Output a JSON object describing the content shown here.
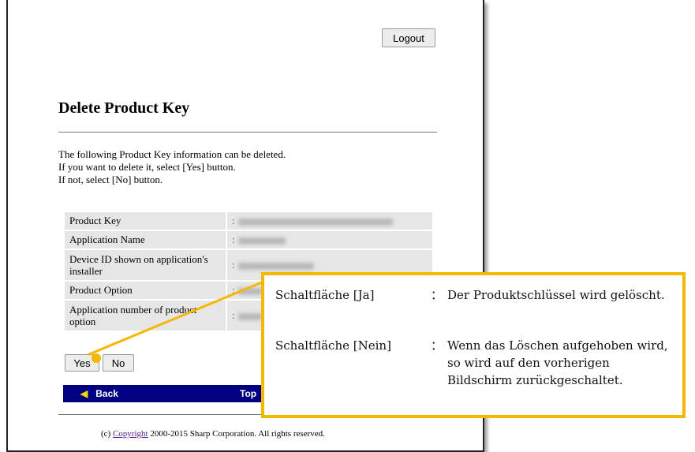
{
  "header": {
    "logout_label": "Logout"
  },
  "page": {
    "title": "Delete Product Key",
    "intro_lines": [
      "The following Product Key information can be deleted.",
      "If you want to delete it, select [Yes] button.",
      "If not, select [No] button."
    ]
  },
  "table": {
    "rows": [
      {
        "label": "Product Key",
        "value": ":"
      },
      {
        "label": "Application Name",
        "value": ":"
      },
      {
        "label": "Device ID shown on application's installer",
        "value": ":"
      },
      {
        "label": "Product Option",
        "value": ":"
      },
      {
        "label": "Application number of product option",
        "value": ":"
      }
    ]
  },
  "actions": {
    "yes_label": "Yes",
    "no_label": "No"
  },
  "navbar": {
    "back_label": "Back",
    "top_label": "Top"
  },
  "footer": {
    "prefix": "(c) ",
    "copyright_link": "Copyright",
    "suffix": " 2000-2015 Sharp Corporation. All rights reserved."
  },
  "callout": {
    "items": [
      {
        "term": "Schaltfläche [Ja]",
        "colon": "：",
        "description": "Der Produktschlüssel wird gelöscht."
      },
      {
        "term": "Schaltfläche [Nein]",
        "colon": "：",
        "description": "Wenn das Löschen aufgehoben wird, so wird auf den vorherigen Bildschirm zurückgeschaltet."
      }
    ]
  },
  "colors": {
    "accent": "#f5b800",
    "navbar": "#000080",
    "cell_background": "#e6e6e6"
  },
  "icons": {
    "back_arrow": "triangle-left-icon"
  }
}
